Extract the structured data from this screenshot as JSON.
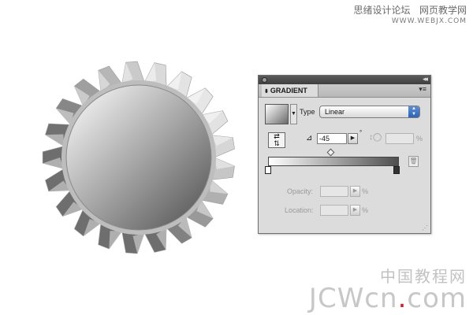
{
  "watermark_top": {
    "site_name": "思绪设计论坛",
    "site_name_2": "网页教学网",
    "url": "WWW.WEBJX.COM"
  },
  "watermark_bottom": {
    "cn": "中国教程网",
    "logo_text": "JCWcn",
    "logo_dot": ".",
    "logo_suffix": "com"
  },
  "gradient_panel": {
    "tab_label": "GRADIENT",
    "type_label": "Type",
    "type_value": "Linear",
    "angle_value": "-45",
    "angle_unit": "°",
    "aspect_unit": "%",
    "opacity_label": "Opacity:",
    "opacity_unit": "%",
    "location_label": "Location:",
    "location_unit": "%",
    "gradient_start_color": "#ffffff",
    "gradient_end_color": "#4e4e4e",
    "gradient_angle_deg": -45
  },
  "colors": {
    "panel_bg": "#dcdcdc",
    "titlebar": "#4a4a4a",
    "select_accent": "#2e62b8"
  }
}
